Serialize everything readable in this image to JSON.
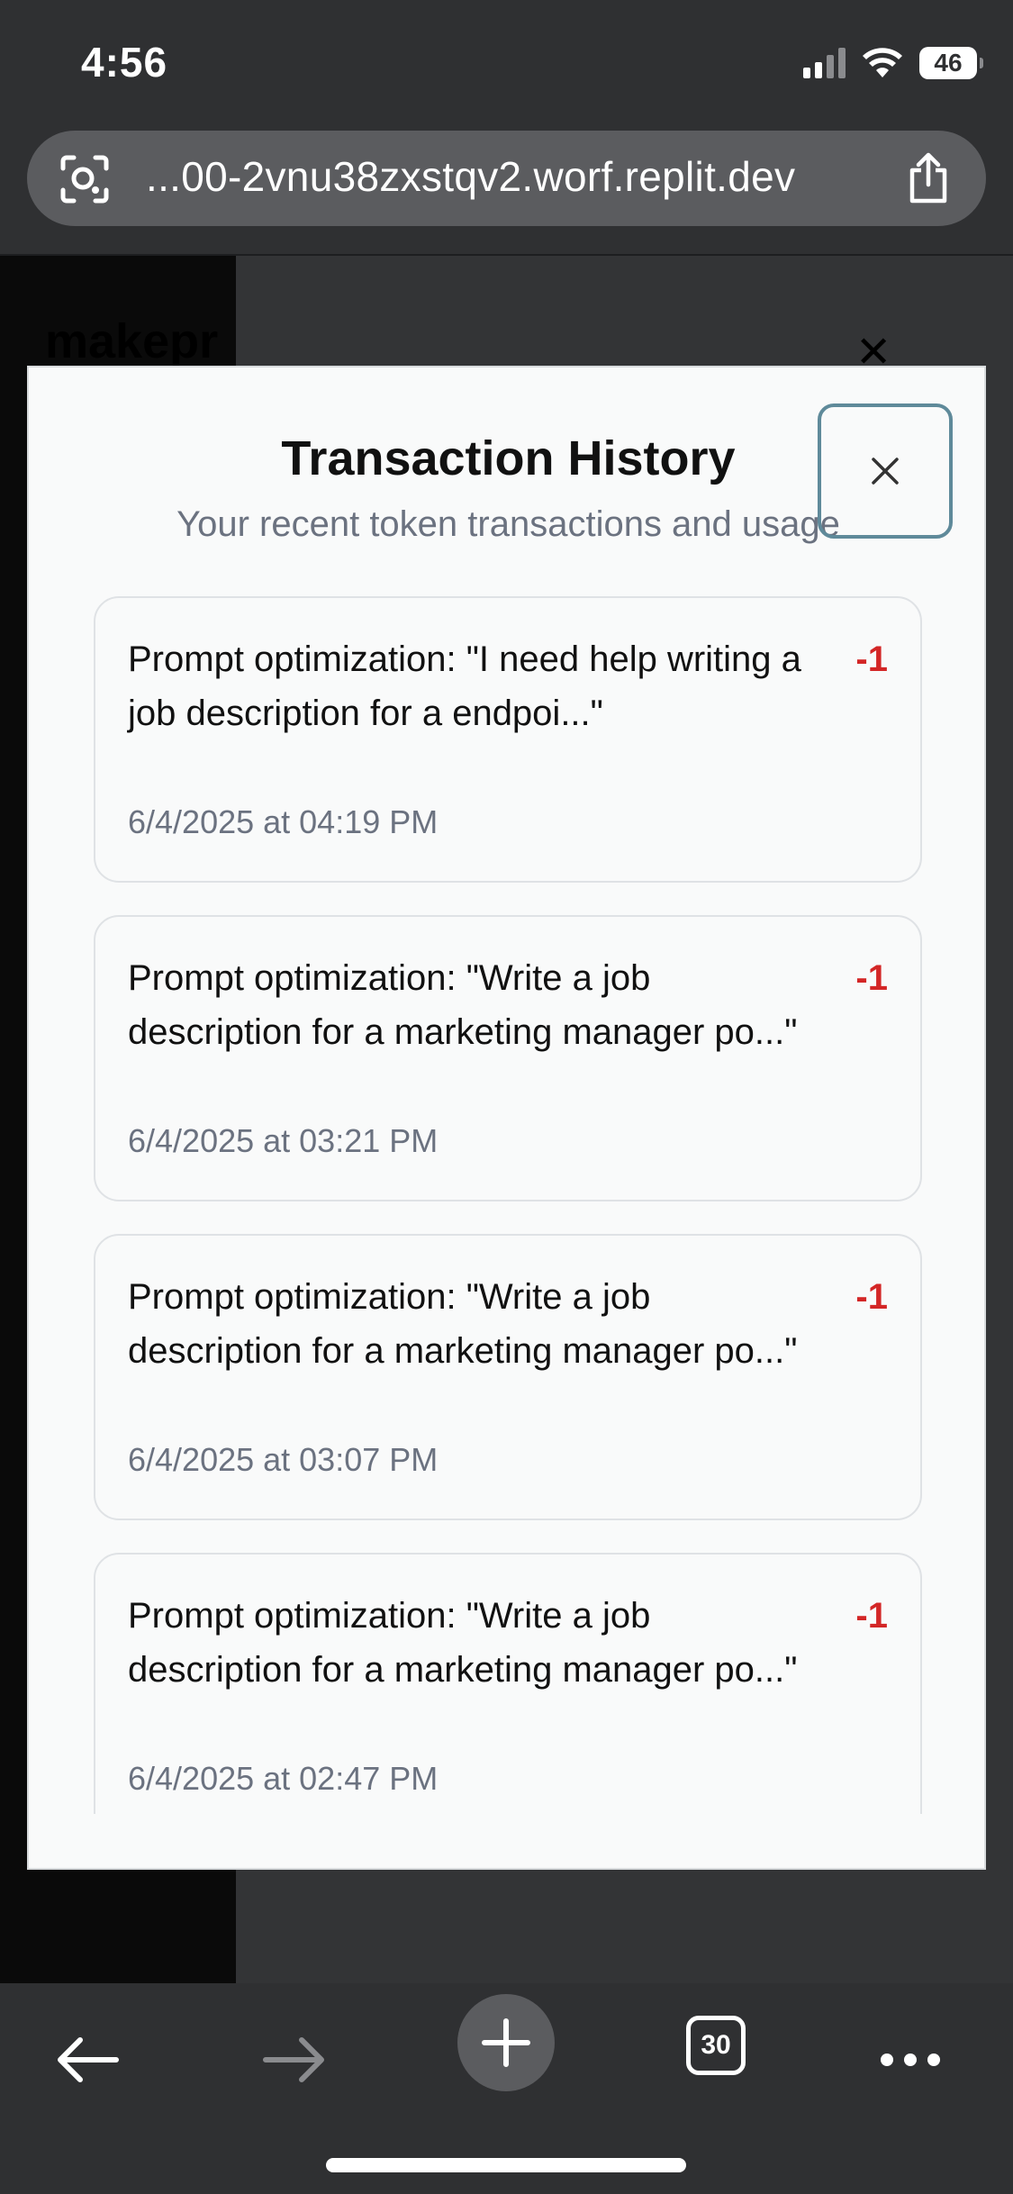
{
  "status_bar": {
    "time": "4:56",
    "battery": "46"
  },
  "browser": {
    "url": "...00-2vnu38zxstqv2.worf.replit.dev",
    "tab_count": "30"
  },
  "background_page": {
    "brand": "makepr"
  },
  "modal": {
    "title": "Transaction History",
    "subtitle": "Your recent token transactions and usage",
    "transactions": [
      {
        "description": "Prompt optimization: \"I need help writing a job description for a endpoi...\"",
        "date": "6/4/2025 at 04:19 PM",
        "amount": "-1"
      },
      {
        "description": "Prompt optimization: \"Write a job description for a marketing manager po...\"",
        "date": "6/4/2025 at 03:21 PM",
        "amount": "-1"
      },
      {
        "description": "Prompt optimization: \"Write a job description for a marketing manager po...\"",
        "date": "6/4/2025 at 03:07 PM",
        "amount": "-1"
      },
      {
        "description": "Prompt optimization: \"Write a job description for a marketing manager po...\"",
        "date": "6/4/2025 at 02:47 PM",
        "amount": "-1"
      }
    ]
  },
  "colors": {
    "amount_negative": "#d32626",
    "close_focus_ring": "#5f8a9a",
    "browser_chrome": "#2f3032"
  },
  "icons": {
    "address_left": "visual-search-icon",
    "address_right": "share-icon",
    "modal_close": "close-icon",
    "toolbar": [
      "back-arrow-icon",
      "forward-arrow-icon",
      "plus-icon",
      "tabs-icon",
      "more-icon"
    ]
  }
}
